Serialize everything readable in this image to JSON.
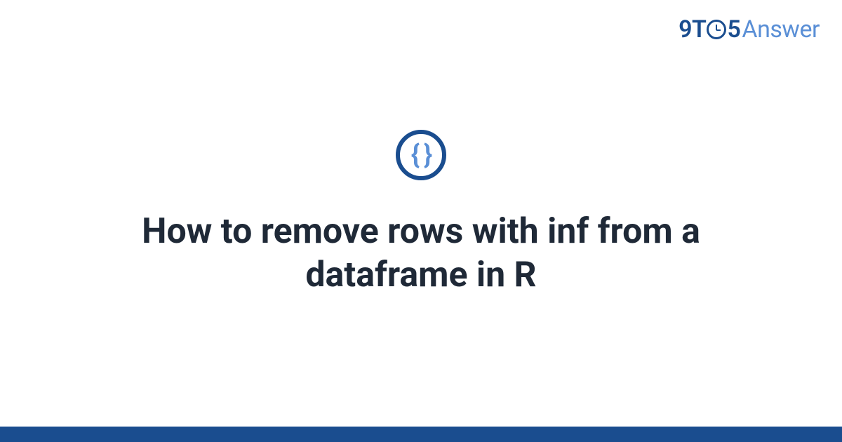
{
  "brand": {
    "prefix_nine": "9",
    "prefix_t": "T",
    "suffix_five": "5",
    "suffix_answer": "Answer"
  },
  "icon": {
    "braces": "{ }"
  },
  "title": "How to remove rows with inf from a dataframe in R",
  "colors": {
    "brand_dark": "#1a4d8f",
    "brand_light": "#5a8fd6",
    "text": "#1f2937"
  }
}
